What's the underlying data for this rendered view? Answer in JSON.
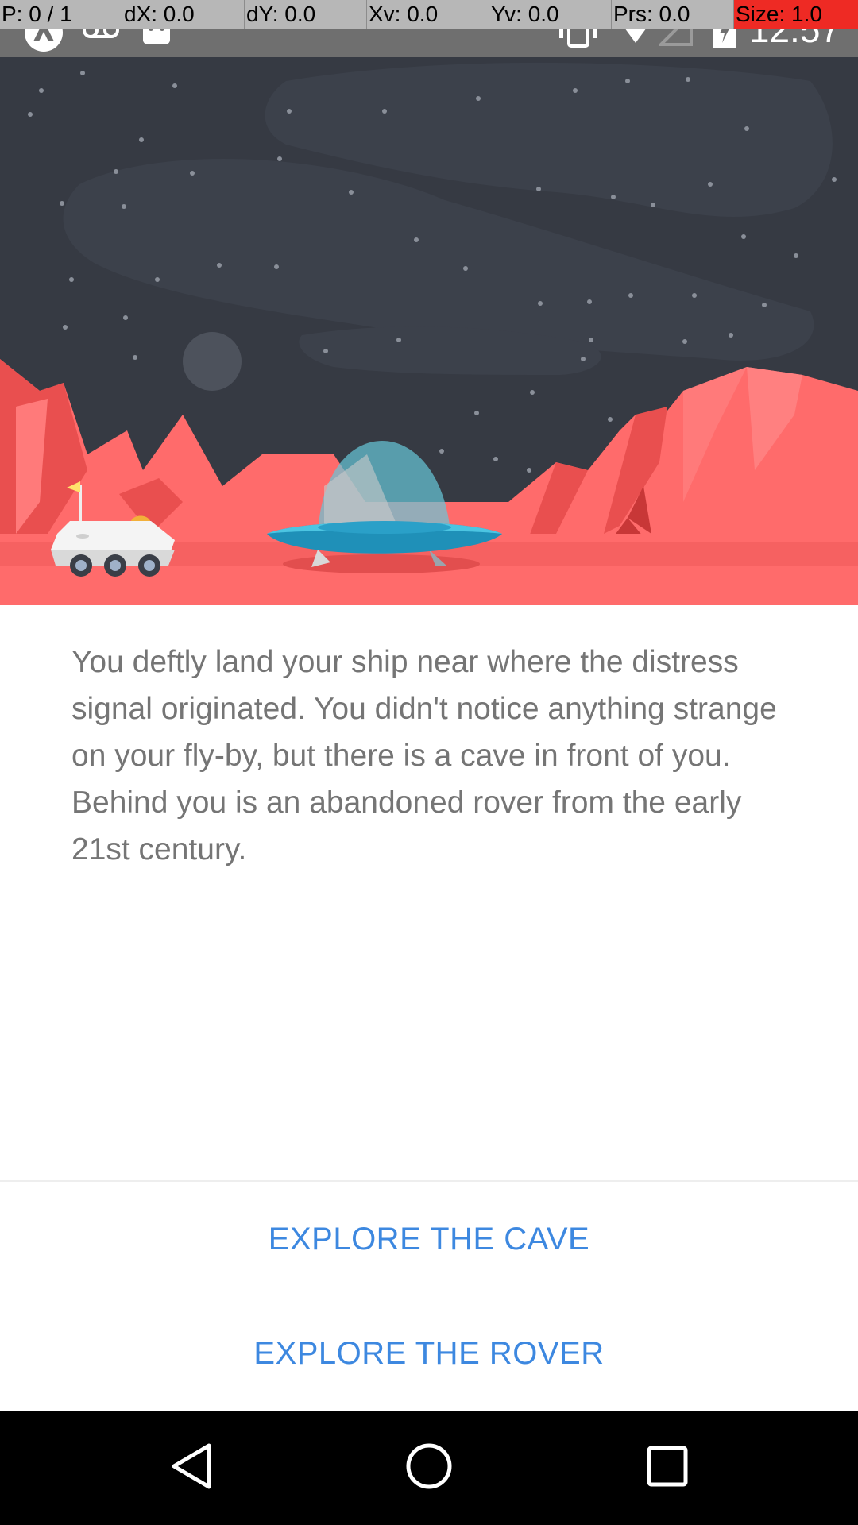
{
  "debug_overlay": {
    "pointer": "P: 0 / 1",
    "dx": "dX: 0.0",
    "dy": "dY: 0.0",
    "xv": "Xv: 0.0",
    "yv": "Yv: 0.0",
    "pressure": "Prs: 0.0",
    "size": "Size: 1.0"
  },
  "status_bar": {
    "time": "12:57",
    "icons": [
      "app-notification-icon",
      "voicemail-icon",
      "android-icon",
      "vibrate-icon",
      "wifi-icon",
      "no-signal-icon",
      "battery-charging-icon"
    ]
  },
  "story": {
    "text": "You deftly land your ship near where the distress signal originated. You didn't notice anything strange on your fly-by, but there is a cave in front of you. Behind you is an abandoned rover from the early 21st century."
  },
  "choices": [
    {
      "label": "EXPLORE THE CAVE"
    },
    {
      "label": "EXPLORE THE ROVER"
    }
  ],
  "colors": {
    "sky": "#363a43",
    "terrain": "#ff6b6b",
    "terrain_dark": "#e54848",
    "ship": "#42b4d6",
    "choice_text": "#3d88e0",
    "story_text": "#757575"
  },
  "nav_bar": {
    "icons": [
      "back-icon",
      "home-icon",
      "recents-icon"
    ]
  }
}
